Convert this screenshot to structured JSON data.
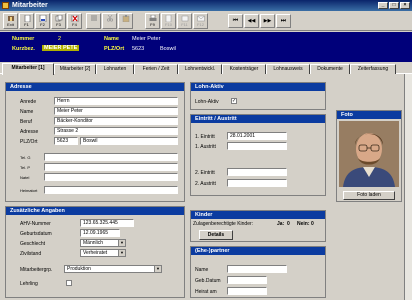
{
  "window": {
    "title": "Mitarbeiter",
    "controls": [
      "_",
      "□",
      "×"
    ]
  },
  "toolbar": {
    "buttons": [
      {
        "label": "Exit",
        "icon": "exit-icon",
        "enabled": true
      },
      {
        "label": "F1",
        "icon": "new-document-icon",
        "enabled": true
      },
      {
        "label": "F2",
        "icon": "save-icon",
        "enabled": true
      },
      {
        "label": "F3",
        "icon": "copy-icon",
        "enabled": true
      },
      {
        "label": "F4",
        "icon": "delete-icon",
        "enabled": true
      },
      {
        "label": "",
        "icon": "list-icon",
        "enabled": false
      },
      {
        "label": "",
        "icon": "cut-icon",
        "enabled": false
      },
      {
        "label": "",
        "icon": "paste-icon",
        "enabled": false
      },
      {
        "label": "F9",
        "icon": "print-icon",
        "enabled": true
      },
      {
        "label": "F10",
        "icon": "preview-icon",
        "enabled": false
      },
      {
        "label": "F11",
        "icon": "export-icon",
        "enabled": false
      },
      {
        "label": "F12",
        "icon": "mail-icon",
        "enabled": false
      }
    ],
    "nav": [
      "⏮",
      "◀◀",
      "▶▶",
      "⏭"
    ]
  },
  "header": {
    "nummer_label": "Nummer",
    "nummer_value": "2",
    "kurzbez_label": "Kurzbez.",
    "kurzbez_value": "MEIER PETE",
    "name_label": "Name",
    "name_value": "Meier Peter",
    "plz_label": "PLZ/Ort",
    "plz_value": "5623",
    "ort_value": "Boswil"
  },
  "tabs": [
    "Mitarbeiter [1]",
    "Mitarbeiter [2]",
    "Lohnarten",
    "Ferien / Zeit",
    "Lohnentwickl.",
    "Kostenträger",
    "Lohnausweis",
    "Dokumente",
    "Zeiterfassung"
  ],
  "adresse": {
    "title": "Adresse",
    "anrede_label": "Anrede",
    "anrede": "Herrn",
    "name_label": "Name",
    "name": "Meier Peter",
    "beruf_label": "Beruf",
    "beruf": "Bäcker-Konditor",
    "adresse_label": "Adresse",
    "adresse": "Strasse 2",
    "plz_label": "PLZ/Ort",
    "plz": "5623",
    "ort": "Boswil",
    "telg_label": "Tel. G",
    "telp_label": "Tel. P",
    "natel_label": "Natel",
    "heimatort_label": "Heimatort"
  },
  "lohn": {
    "title": "Lohn-Aktiv",
    "aktiv_label": "Lohn-Aktiv",
    "aktiv_checked": "✓"
  },
  "eintritt": {
    "title": "Eintritt / Austritt",
    "e1_label": "1. Eintritt",
    "e1": "28.01.2001",
    "a1_label": "1. Austritt",
    "e2_label": "2. Eintritt",
    "a2_label": "2. Austritt"
  },
  "foto": {
    "title": "Foto",
    "button": "Foto laden"
  },
  "zusatz": {
    "title": "Zusätzliche Angaben",
    "ahv_label": "AHV-Nummer",
    "ahv": "123.65.325.445",
    "geb_label": "Geburtsdatum",
    "geb": "12.09.1965",
    "geschlecht_label": "Geschlecht",
    "geschlecht": "Männlich",
    "zivil_label": "Zivilstand",
    "zivil": "Verheiratet",
    "gruppe_label": "Mitarbeitergrp.",
    "gruppe": "Produktion",
    "lehrling_label": "Lehrling"
  },
  "kinder": {
    "title": "Kinder",
    "zulagen_label": "Zulagenberechtigte Kinder:",
    "ja_label": "Ja:",
    "ja": "0",
    "nein_label": "Nein:",
    "nein": "0",
    "details": "Details"
  },
  "partner": {
    "title": "(Ehe-)partner",
    "name_label": "Name",
    "geb_label": "Geb.Datum",
    "heirat_label": "Heirat am"
  },
  "colors": {
    "header_bg": "#00007a",
    "panel_head": "#0b3ba0",
    "highlight": "#ffff40"
  }
}
